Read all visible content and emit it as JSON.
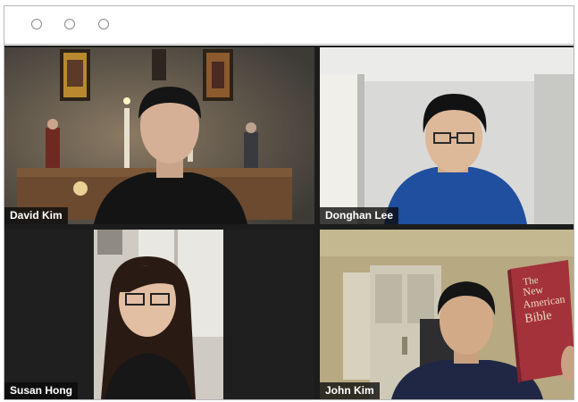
{
  "window": {
    "controls": [
      "window-control-1",
      "window-control-2",
      "window-control-3"
    ]
  },
  "participants": [
    {
      "name": "David Kim"
    },
    {
      "name": "Donghan Lee"
    },
    {
      "name": "Susan Hong"
    },
    {
      "name": "John Kim"
    }
  ],
  "book_cover": {
    "line1": "The",
    "line2": "New",
    "line3": "American",
    "line4": "Bible"
  },
  "colors": {
    "titlebar_bg": "#ffffff",
    "window_controls": "#8a8a8a",
    "grid_bg": "#1c1c1c",
    "name_label_bg": "#141414",
    "name_label_text": "#ffffff",
    "bible_cover": "#a3323a"
  }
}
